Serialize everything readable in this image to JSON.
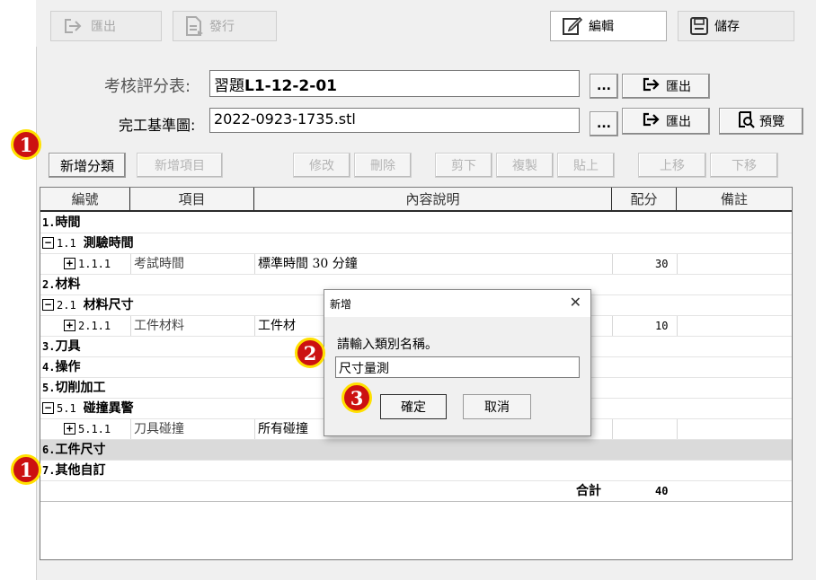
{
  "toolbar": {
    "export_label": "匯出",
    "publish_label": "發行",
    "edit_label": "編輯",
    "save_label": "儲存"
  },
  "form": {
    "sheet_label": "考核評分表:",
    "sheet_value_prefix": "習題",
    "sheet_value_bold": "L1-12-2-01",
    "ref_label": "完工基準圖:",
    "ref_value": "2022-0923-1735.stl",
    "browse_label": "...",
    "export_label": "匯出",
    "preview_label": "預覽"
  },
  "actions": {
    "add_category": "新增分類",
    "add_item": "新增項目",
    "modify": "修改",
    "delete": "刪除",
    "cut": "剪下",
    "copy": "複製",
    "paste": "貼上",
    "move_up": "上移",
    "move_down": "下移"
  },
  "table": {
    "headers": [
      "編號",
      "項目",
      "內容說明",
      "配分",
      "備註"
    ],
    "rows": [
      {
        "id": "1.",
        "name": "時間"
      },
      {
        "toggle": "−",
        "id": "1.1",
        "name": "測驗時間"
      },
      {
        "toggle": "+",
        "id": "1.1.1",
        "item": "考試時間",
        "desc": "標準時間 30 分鐘",
        "score": "30"
      },
      {
        "id": "2.",
        "name": "材料"
      },
      {
        "toggle": "−",
        "id": "2.1",
        "name": "材料尺寸"
      },
      {
        "toggle": "+",
        "id": "2.1.1",
        "item": "工件材料",
        "desc": "工件材",
        "score": "10"
      },
      {
        "id": "3.",
        "name": "刀具"
      },
      {
        "id": "4.",
        "name": "操作"
      },
      {
        "id": "5.",
        "name": "切削加工"
      },
      {
        "toggle": "−",
        "id": "5.1",
        "name": "碰撞異警"
      },
      {
        "toggle": "+",
        "id": "5.1.1",
        "item": "刀具碰撞",
        "desc": "所有碰撞"
      },
      {
        "id": "6.",
        "name": "工件尺寸"
      },
      {
        "id": "7.",
        "name": "其他自訂"
      }
    ],
    "total_label": "合計",
    "total_value": "40"
  },
  "dialog": {
    "title": "新增",
    "close": "✕",
    "prompt": "請輸入類別名稱。",
    "value": "尺寸量測",
    "ok": "確定",
    "cancel": "取消"
  },
  "markers": {
    "m1": "1",
    "m2": "2",
    "m3": "3"
  },
  "colors": {
    "marker_fill": "#cc1111",
    "marker_ring": "#ffe000",
    "selected_row": "#dadada"
  }
}
